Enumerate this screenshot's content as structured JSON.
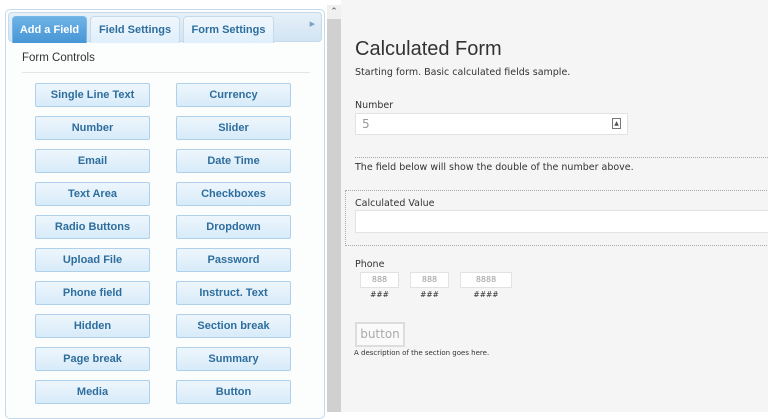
{
  "tabs": [
    {
      "label": "Add a Field",
      "active": true
    },
    {
      "label": "Field Settings"
    },
    {
      "label": "Form Settings"
    }
  ],
  "section_label": "Form Controls",
  "controls": [
    "Single Line Text",
    "Currency",
    "Number",
    "Slider",
    "Email",
    "Date Time",
    "Text Area",
    "Checkboxes",
    "Radio Buttons",
    "Dropdown",
    "Upload File",
    "Password",
    "Phone field",
    "Instruct. Text",
    "Hidden",
    "Section break",
    "Page break",
    "Summary",
    "Media",
    "Button"
  ],
  "form": {
    "title": "Calculated Form",
    "subtitle": "Starting form. Basic calculated fields sample.",
    "number_label": "Number",
    "number_value": "5",
    "instruction": "The field below will show the double of the number above.",
    "calc_label": "Calculated Value",
    "calc_value": "",
    "phone_label": "Phone",
    "phone_parts": [
      {
        "placeholder": "888",
        "format": "###"
      },
      {
        "placeholder": "888",
        "format": "###"
      },
      {
        "placeholder": "8888",
        "format": "####"
      }
    ],
    "button_label": "button",
    "section_desc": "A description of the section goes here."
  }
}
